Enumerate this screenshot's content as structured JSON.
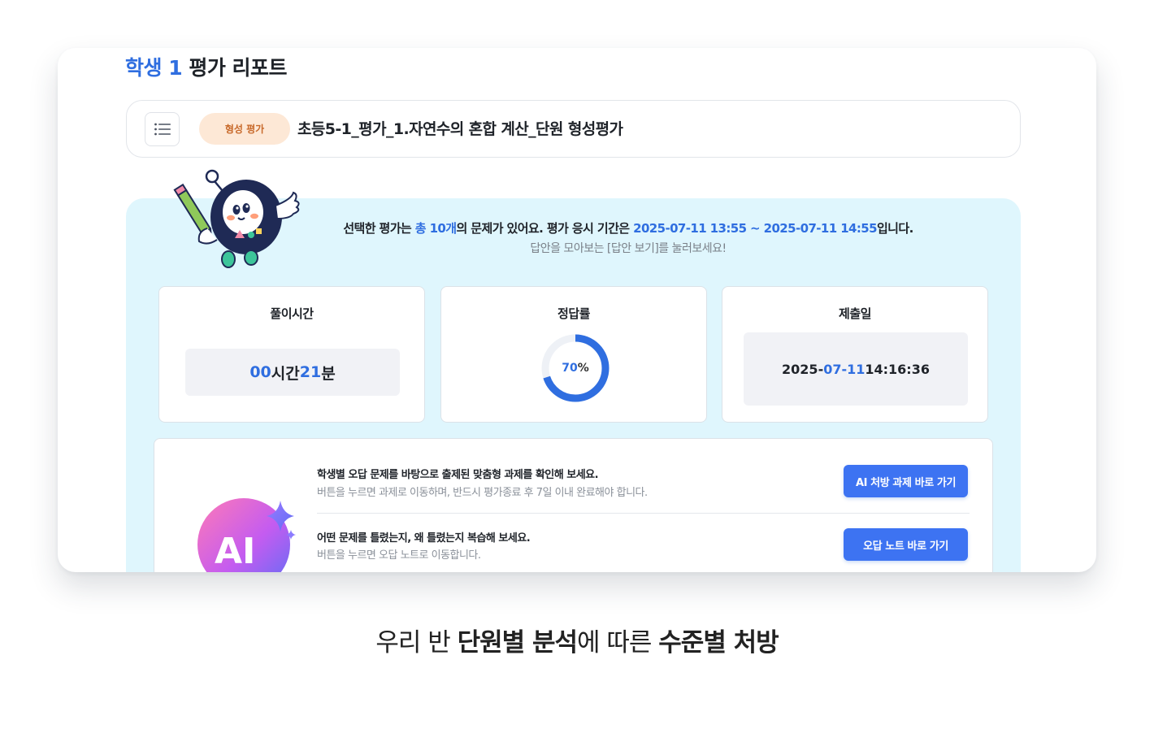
{
  "report": {
    "student": "학생 1",
    "title": " 평가 리포트"
  },
  "assessment": {
    "type_badge": "형성 평가",
    "name": "초등5-1_평가_1.자연수의 혼합 계산_단원 형성평가"
  },
  "intro": {
    "p1": "선택한 평가는 ",
    "total": "총 10개",
    "p2": "의 문제가 있어요. 평가 응시 기간은 ",
    "period": "2025-07-11 13:55 ~ 2025-07-11 14:55",
    "p3": "입니다.",
    "sub": "답안을 모아보는 [답안 보기]를 눌러보세요!"
  },
  "stats": {
    "solve_time": {
      "label": "풀이시간",
      "hours": "00",
      "hours_unit": "시간 ",
      "minutes": "21",
      "minutes_unit": "분"
    },
    "accuracy": {
      "label": "정답률",
      "value": "70",
      "unit": "%",
      "fraction": 0.7
    },
    "submitted": {
      "label": "제출일",
      "year": "2025-",
      "month_day": "07-11",
      "time": " 14:16:36"
    }
  },
  "ai_section": {
    "row1": {
      "main": "학생별 오답 문제를 바탕으로 출제된 맞춤형 과제를 확인해 보세요.",
      "sub": "버튼을 누르면 과제로 이동하며, 반드시 평가종료 후 7일 이내 완료해야 합니다.",
      "button": "AI 처방 과제 바로 가기"
    },
    "row2": {
      "main": "어떤 문제를 틀렸는지, 왜 틀렸는지 복습해 보세요.",
      "sub": "버튼을 누르면 오답 노트로 이동합니다.",
      "button": "오답 노트 바로 가기"
    },
    "logo_text": "AI"
  },
  "caption": {
    "t1": "우리 반 ",
    "b1": "단원별 분석",
    "t2": "에 따른 ",
    "b2": "수준별 처방"
  },
  "colors": {
    "accent": "#2f6ee0",
    "panel_bg": "#dff6fd",
    "badge_bg": "#fde8d6",
    "badge_text": "#c8692a",
    "button_bg": "#3d73f2"
  },
  "icons": [
    "list-icon",
    "mascot-robot-icon",
    "ai-logo-icon"
  ]
}
